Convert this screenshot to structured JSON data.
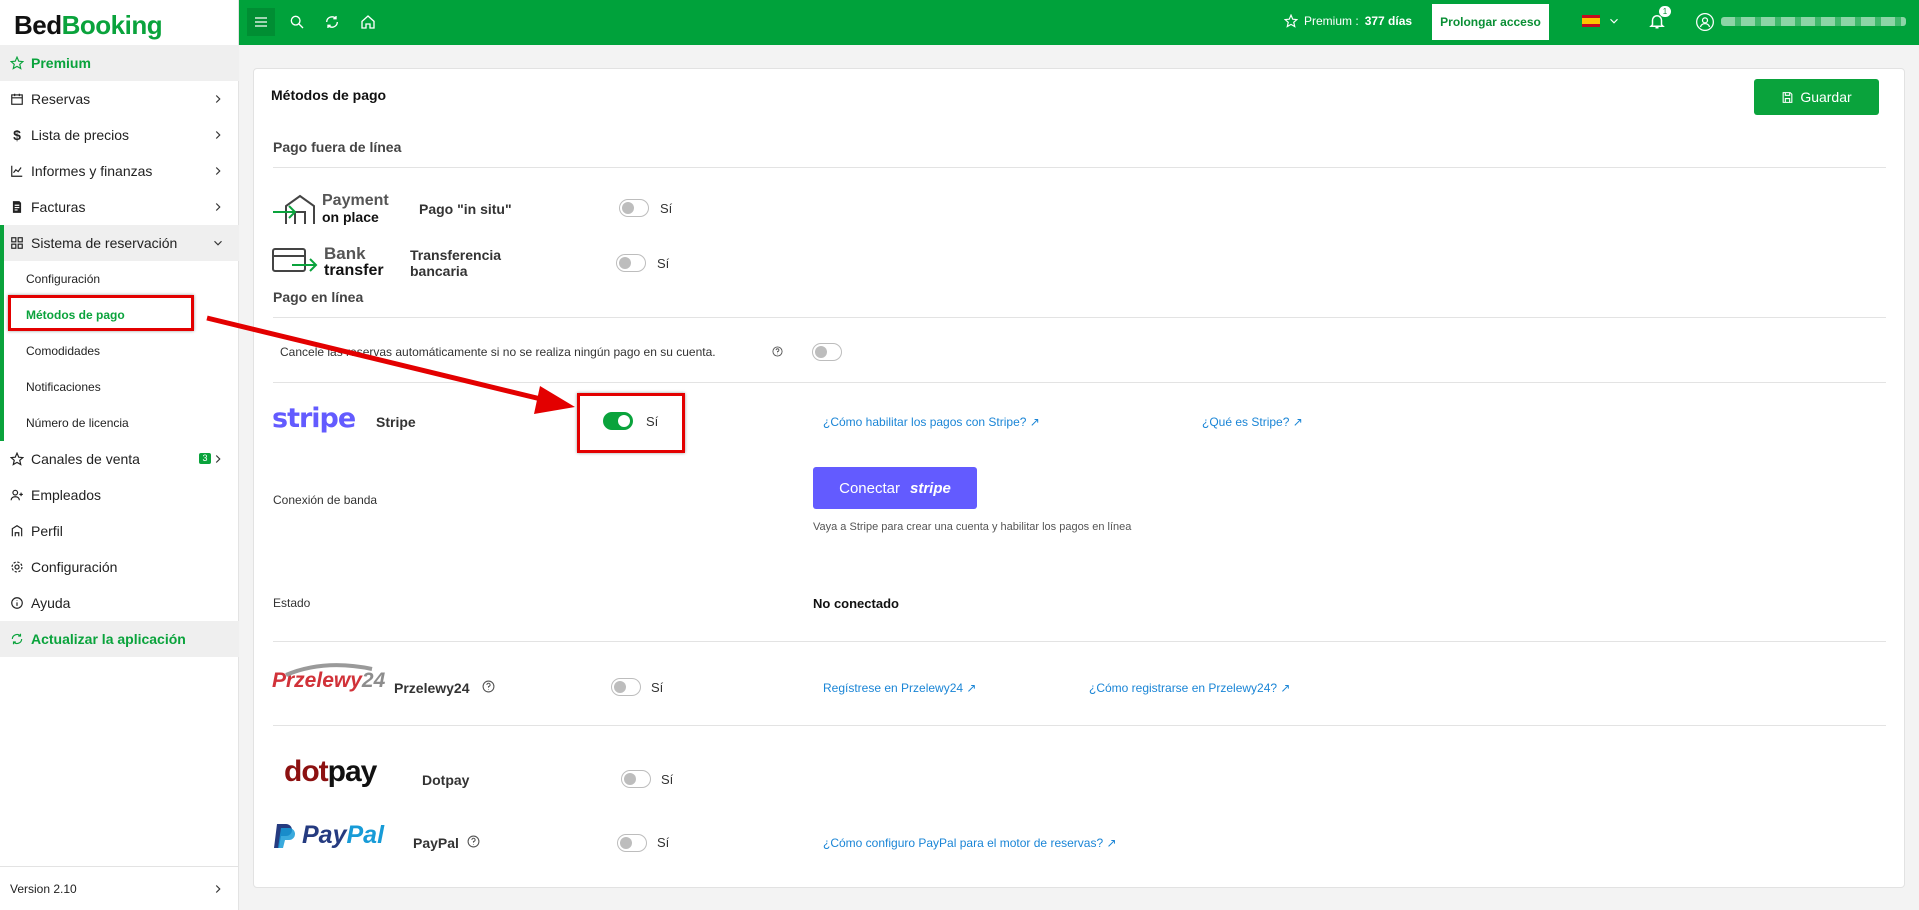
{
  "brand": {
    "part1": "Bed",
    "part2": "Booking"
  },
  "sidebar": {
    "premium": "Premium",
    "items": [
      {
        "label": "Reservas"
      },
      {
        "label": "Lista de precios"
      },
      {
        "label": "Informes y finanzas"
      },
      {
        "label": "Facturas"
      },
      {
        "label": "Sistema de reservación"
      }
    ],
    "sub_items": [
      {
        "label": "Configuración"
      },
      {
        "label": "Métodos de pago"
      },
      {
        "label": "Comodidades"
      },
      {
        "label": "Notificaciones"
      },
      {
        "label": "Número de licencia"
      }
    ],
    "items2": [
      {
        "label": "Canales de venta",
        "badge": "3"
      },
      {
        "label": "Empleados"
      },
      {
        "label": "Perfil"
      },
      {
        "label": "Configuración"
      },
      {
        "label": "Ayuda"
      }
    ],
    "update_app": "Actualizar la aplicación",
    "version": "Version 2.10"
  },
  "topbar": {
    "premium_label": "Premium :",
    "premium_days": "377 días",
    "prolongar": "Prolongar acceso",
    "notif_count": "1"
  },
  "page": {
    "title": "Métodos de pago",
    "save": "Guardar",
    "offline_section": "Pago fuera de línea",
    "online_section": "Pago en línea",
    "payment_on_place_logo": {
      "line1": "Payment",
      "line2": "on place"
    },
    "bank_transfer_logo": {
      "line1": "Bank",
      "line2": "transfer"
    },
    "pago_in_situ": "Pago \"in situ\"",
    "transferencia_1": "Transferencia",
    "transferencia_2": "bancaria",
    "si": "Sí",
    "cancel_text": "Cancele las reservas automáticamente si no se realiza ningún pago en su cuenta.",
    "stripe_logo": "stripe",
    "stripe_label": "Stripe",
    "stripe_link1": "¿Cómo habilitar los pagos con Stripe?",
    "stripe_link2": "¿Qué es Stripe?",
    "conexion_label": "Conexión de banda",
    "connect_btn": "Conectar",
    "connect_btn_logo": "stripe",
    "connect_help": "Vaya a Stripe para crear una cuenta y habilitar los pagos en línea",
    "estado_label": "Estado",
    "estado_value": "No conectado",
    "przelewy_logo_a": "Przelewy",
    "przelewy_logo_b": "24",
    "przelewy_label": "Przelewy24",
    "przelewy_link1": "Regístrese en Przelewy24",
    "przelewy_link2": "¿Cómo registrarse en Przelewy24?",
    "dotpay_logo_a": "dot",
    "dotpay_logo_b": "pay",
    "dotpay_label": "Dotpay",
    "paypal_logo_a": "Pay",
    "paypal_logo_b": "Pal",
    "paypal_label": "PayPal",
    "paypal_link": "¿Cómo configuro PayPal para el motor de reservas?"
  },
  "toggles": {
    "in_situ": false,
    "transfer": false,
    "auto_cancel": false,
    "stripe": true,
    "przelewy": false,
    "dotpay": false,
    "paypal": false
  },
  "colors": {
    "brand_green": "#00a23b",
    "stripe": "#635bff",
    "link": "#1a85d6",
    "annotation": "#e30000"
  }
}
